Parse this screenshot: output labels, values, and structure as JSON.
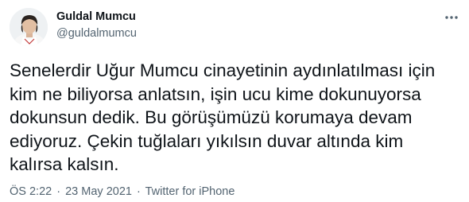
{
  "author": {
    "name": "Guldal Mumcu",
    "handle": "@guldalmumcu"
  },
  "icons": {
    "more": "more-horizontal-icon",
    "avatar": "avatar-photo"
  },
  "tweet": {
    "lines": [
      "Senelerdir Uğur Mumcu cinayetinin aydınlatılması için",
      "kim ne biliyorsa anlatsın, işin ucu kime dokunuyorsa",
      "dokunsun dedik. Bu görüşümüzü korumaya devam",
      "ediyoruz. Çekin tuğlaları yıkılsın duvar altında kim",
      "kalırsa kalsın."
    ]
  },
  "meta": {
    "time": "ÖS 2:22",
    "separator": "·",
    "date": "23 May 2021",
    "source": "Twitter for iPhone"
  },
  "colors": {
    "text": "#0f1419",
    "secondary": "#536471"
  }
}
